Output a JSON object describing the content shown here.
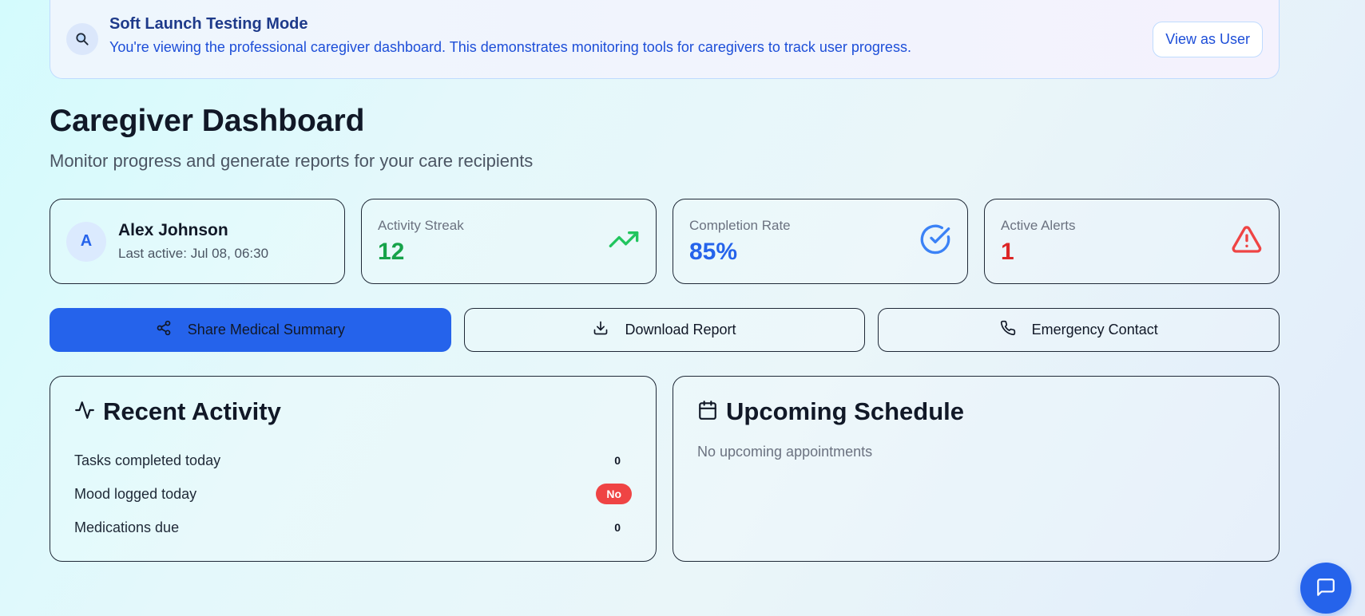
{
  "banner": {
    "icon": "magnifier-icon",
    "title": "Soft Launch Testing Mode",
    "description": "You're viewing the professional caregiver dashboard. This demonstrates monitoring tools for caregivers to track user progress.",
    "button_label": "View as User"
  },
  "page": {
    "title": "Caregiver Dashboard",
    "subtitle": "Monitor progress and generate reports for your care recipients"
  },
  "user_card": {
    "initial": "A",
    "name": "Alex Johnson",
    "last_active": "Last active: Jul 08, 06:30"
  },
  "stats": [
    {
      "label": "Activity Streak",
      "value": "12",
      "icon": "trending-up-icon",
      "color": "#16a34a"
    },
    {
      "label": "Completion Rate",
      "value": "85%",
      "icon": "check-circle-icon",
      "color": "#2563eb"
    },
    {
      "label": "Active Alerts",
      "value": "1",
      "icon": "alert-triangle-icon",
      "color": "#dc2626"
    }
  ],
  "actions": [
    {
      "label": "Share Medical Summary",
      "icon": "share-icon"
    },
    {
      "label": "Download Report",
      "icon": "download-icon"
    },
    {
      "label": "Emergency Contact",
      "icon": "phone-icon"
    }
  ],
  "recent_activity": {
    "title": "Recent Activity",
    "icon": "activity-icon",
    "rows": [
      {
        "label": "Tasks completed today",
        "value": "0"
      },
      {
        "label": "Mood logged today",
        "value": "No"
      },
      {
        "label": "Medications due",
        "value": "0"
      }
    ]
  },
  "schedule": {
    "title": "Upcoming Schedule",
    "icon": "calendar-icon",
    "empty_text": "No upcoming appointments"
  },
  "colors": {
    "accent": "#2563eb",
    "success": "#16a34a",
    "danger": "#dc2626"
  },
  "chat_fab": {
    "icon": "message-icon"
  }
}
